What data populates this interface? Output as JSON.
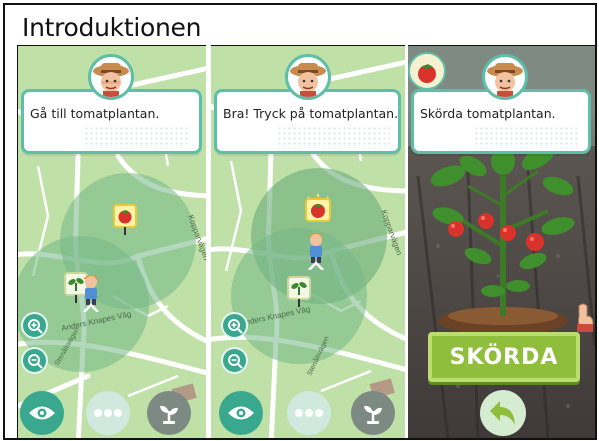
{
  "title": "Introduktionen",
  "screens": [
    {
      "instruction": "Gå till tomatplantan.",
      "map_labels": [
        "Anders Knapes Väg",
        "Kopparvägen",
        "Stenålsvägen"
      ]
    },
    {
      "instruction": "Bra! Tryck på tomatplantan.",
      "map_labels": [
        "Anders Knapes Väg",
        "Kopparvägen",
        "Stenålsvägen"
      ]
    },
    {
      "instruction": "Skörda tomatplantan.",
      "action_label": "SKÖRDA"
    }
  ],
  "icons": {
    "guide": "farmer-avatar-icon",
    "tomato_marker": "tomato-marker-icon",
    "seedling_marker": "seedling-marker-icon",
    "player": "player-character-icon",
    "zoom_in": "zoom-in-icon",
    "zoom_out": "zoom-out-icon",
    "eye": "eye-icon",
    "more": "more-dots-icon",
    "plant": "plant-icon",
    "back": "back-arrow-icon"
  },
  "colors": {
    "teal": "#3aa88e",
    "map_green": "#bfe0a6",
    "harvest_green": "#8fbe3c",
    "tomato_red": "#d8322a"
  }
}
